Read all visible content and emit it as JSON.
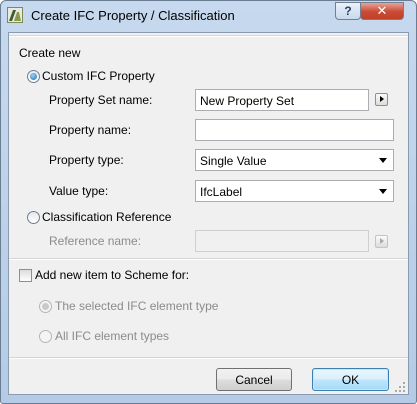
{
  "window": {
    "title": "Create IFC Property / Classification",
    "help_label": "?",
    "close_label": "✕"
  },
  "create_new": {
    "heading": "Create new",
    "custom_option": {
      "label": "Custom IFC Property",
      "selected": true,
      "property_set_name": {
        "label": "Property Set name:",
        "value": "New Property Set"
      },
      "property_name": {
        "label": "Property name:",
        "value": ""
      },
      "property_type": {
        "label": "Property type:",
        "value": "Single Value"
      },
      "value_type": {
        "label": "Value type:",
        "value": "IfcLabel"
      }
    },
    "classification_option": {
      "label": "Classification Reference",
      "selected": false,
      "reference_name": {
        "label": "Reference name:",
        "value": ""
      }
    }
  },
  "scheme": {
    "checkbox_label": "Add new item to Scheme for:",
    "checked": false,
    "selected_type_option": "The selected  IFC element type",
    "all_types_option": "All IFC element types"
  },
  "buttons": {
    "cancel": "Cancel",
    "ok": "OK"
  }
}
